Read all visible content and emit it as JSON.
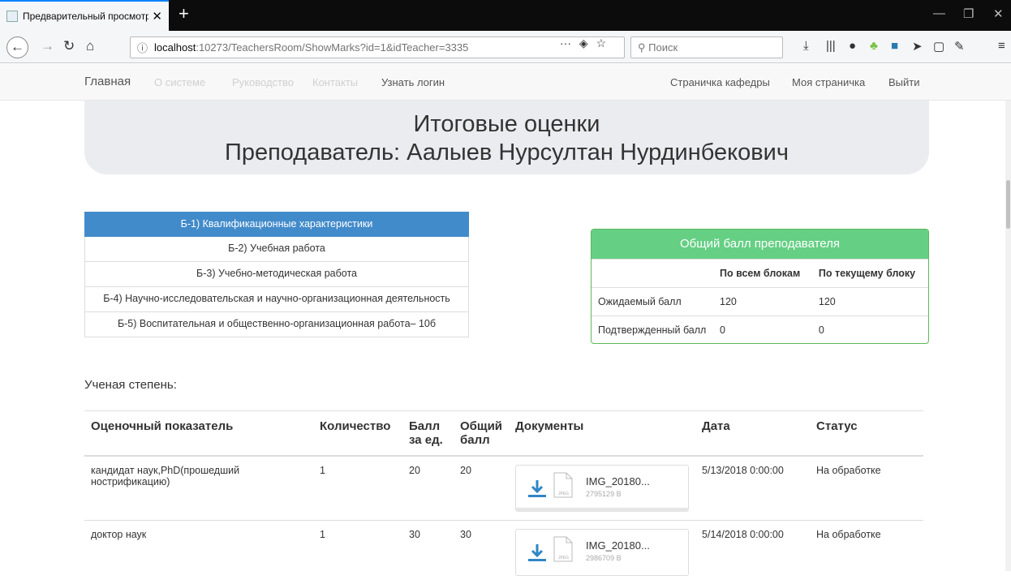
{
  "browser": {
    "tab_title": "Предварительный просмотр",
    "tab_close": "✕",
    "new_tab": "+",
    "url_host": "localhost",
    "url_path": ":10273/TeachersRoom/ShowMarks?id=1&idTeacher=3335",
    "url_more": "···",
    "search_placeholder": "Поиск"
  },
  "sitenav": {
    "brand": "Главная",
    "about": "О системе",
    "guide": "Руководство",
    "contacts": "Контакты",
    "login": "Узнать логин",
    "dept_page": "Страничка кафедры",
    "my_page": "Моя страничка",
    "logout": "Выйти"
  },
  "header": {
    "title": "Итоговые оценки",
    "teacher": "Преподаватель: Аалыев Нурсултан Нурдинбекович"
  },
  "blocks": [
    "Б-1) Квалификационные характеристики",
    "Б-2) Учебная работа",
    "Б-3) Учебно-методическая работа",
    "Б-4) Научно-исследовательская и научно-организационная деятельность",
    "Б-5) Воспитательная и общественно-организационная работа– 10б"
  ],
  "score_panel": {
    "title": "Общий балл преподавателя",
    "col_all": "По всем блокам",
    "col_current": "По текущему блоку",
    "rows": [
      {
        "label": "Ожидаемый балл",
        "all": "120",
        "current": "120"
      },
      {
        "label": "Подтвержденный балл",
        "all": "0",
        "current": "0"
      }
    ]
  },
  "section": {
    "title": "Ученая степень:",
    "columns": [
      "Оценочный показатель",
      "Количество",
      "Балл за ед.",
      "Общий балл",
      "Документы",
      "Дата",
      "Статус"
    ],
    "rows": [
      {
        "indicator": "кандидат наук,PhD(прошедший нострификацию)",
        "qty": "1",
        "unit": "20",
        "total": "20",
        "file": "IMG_20180...",
        "size": "2795129 B",
        "date": "5/13/2018 0:00:00",
        "status": "На обработке"
      },
      {
        "indicator": "доктор наук",
        "qty": "1",
        "unit": "30",
        "total": "30",
        "file": "IMG_20180...",
        "size": "2986709 B",
        "date": "5/14/2018 0:00:00",
        "status": "На обработке"
      }
    ]
  },
  "colors": {
    "accent": "#428bca",
    "panel_header": "#65cf84",
    "status": "#f0ad4e"
  }
}
